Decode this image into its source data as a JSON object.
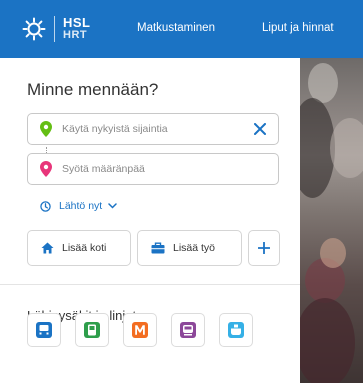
{
  "header": {
    "logo_line1": "HSL",
    "logo_line2": "HRT",
    "nav": [
      "Matkustaminen",
      "Liput ja hinnat"
    ]
  },
  "planner": {
    "title": "Minne mennään?",
    "origin_placeholder": "Käytä nykyistä sijaintia",
    "destination_placeholder": "Syötä määränpää",
    "time_label": "Lähtö nyt",
    "add_home": "Lisää koti",
    "add_work": "Lisää työ"
  },
  "nearby": {
    "title": "Lähipysäkit ja linjat",
    "modes": [
      {
        "name": "bus",
        "color": "#1b73c4"
      },
      {
        "name": "tram",
        "color": "#2e9e4b"
      },
      {
        "name": "metro",
        "color": "#f36d21"
      },
      {
        "name": "train",
        "color": "#8c4799"
      },
      {
        "name": "ferry",
        "color": "#35b0e6"
      }
    ]
  },
  "colors": {
    "brand": "#1b73c4",
    "origin_pin": "#64be14",
    "destination_pin": "#e8357a"
  }
}
